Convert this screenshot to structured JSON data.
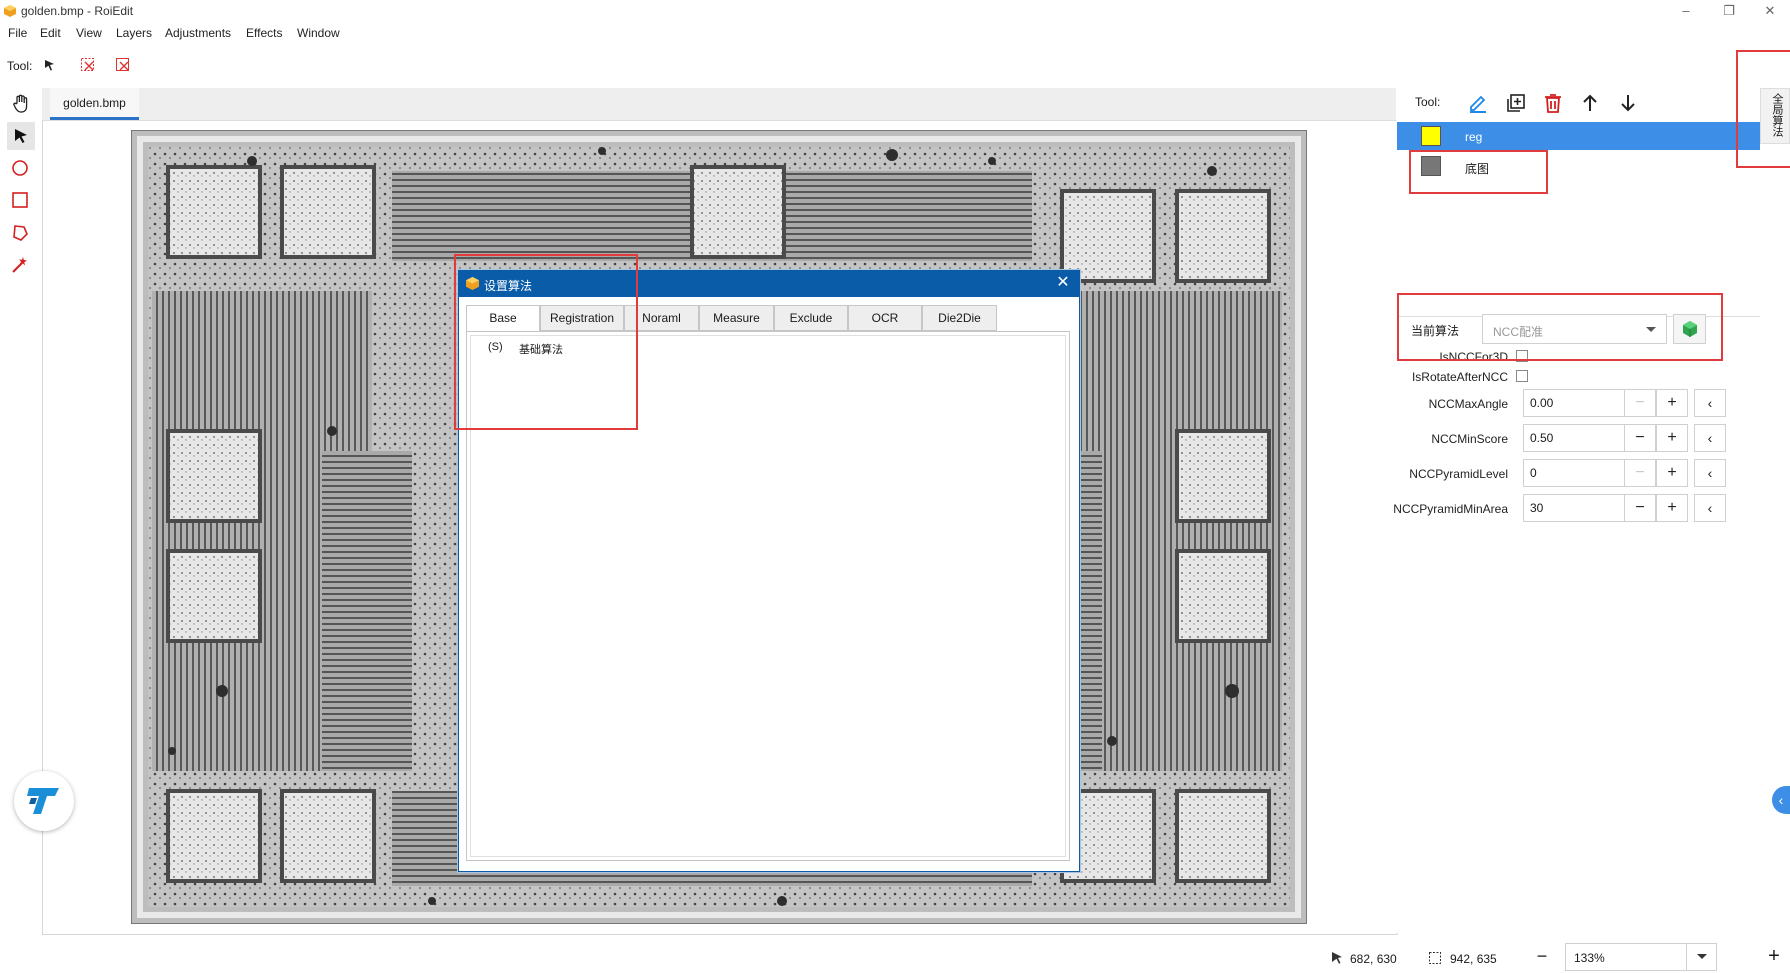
{
  "window": {
    "title": "golden.bmp - RoiEdit"
  },
  "menu": [
    "File",
    "Edit",
    "View",
    "Layers",
    "Adjustments",
    "Effects",
    "Window"
  ],
  "toolbar": {
    "tool_label": "Tool:"
  },
  "document": {
    "tab": "golden.bmp"
  },
  "dialog": {
    "title": "设置算法",
    "tabs": [
      "Base",
      "Registration",
      "Noraml",
      "Measure",
      "Exclude",
      "OCR",
      "Die2Die"
    ],
    "active_tab": "Base",
    "items": [
      {
        "key": "(S)",
        "label": "基础算法"
      }
    ]
  },
  "layers_panel": {
    "tool_label": "Tool:",
    "layers": [
      {
        "name": "reg",
        "color": "#ffff00",
        "selected": true
      },
      {
        "name": "底图",
        "color": "#777777",
        "selected": false
      }
    ]
  },
  "side_tab": {
    "label": "全局算法"
  },
  "algorithm": {
    "label": "当前算法",
    "selected": "NCC配准",
    "props": [
      {
        "name": "IsNCCFor3D",
        "type": "checkbox",
        "checked": false
      },
      {
        "name": "IsRotateAfterNCC",
        "type": "checkbox",
        "checked": false
      },
      {
        "name": "NCCMaxAngle",
        "type": "number",
        "value": "0.00",
        "minus_disabled": true
      },
      {
        "name": "NCCMinScore",
        "type": "number",
        "value": "0.50",
        "minus_disabled": false
      },
      {
        "name": "NCCPyramidLevel",
        "type": "number",
        "value": "0",
        "minus_disabled": true
      },
      {
        "name": "NCCPyramidMinArea",
        "type": "number",
        "value": "30",
        "minus_disabled": false
      }
    ]
  },
  "status": {
    "cursor_pos": "682, 630",
    "selection_size": "942, 635",
    "zoom": "133%"
  },
  "colors": {
    "accent": "#0b5ca8",
    "highlight_row": "#3d8ee6",
    "annotation_red": "#e23b3b"
  }
}
